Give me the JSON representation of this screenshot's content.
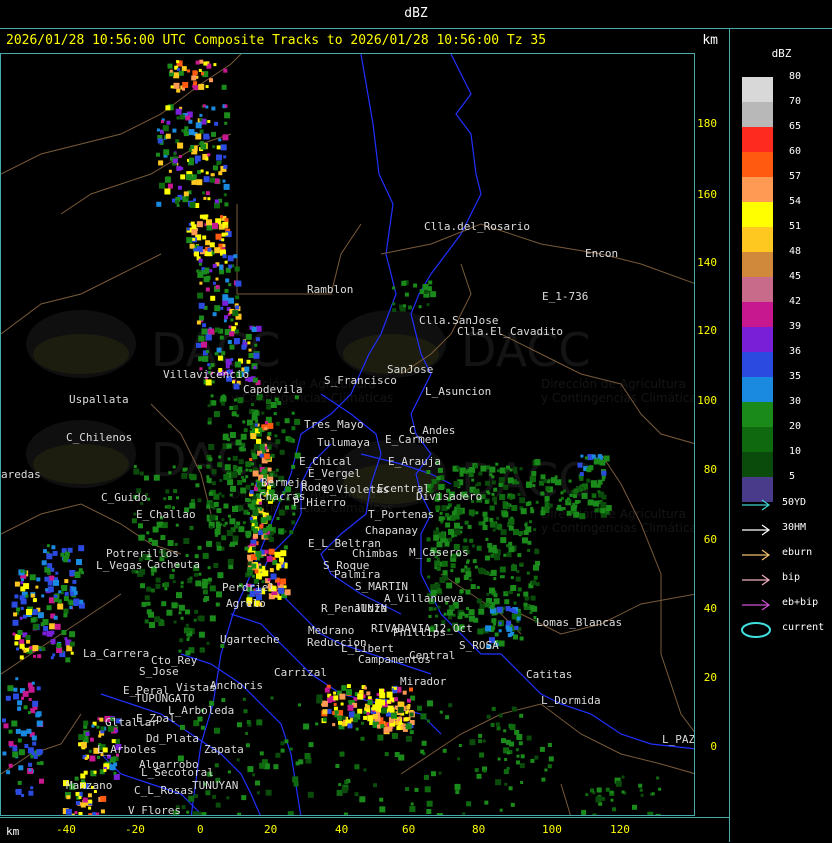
{
  "window_title": "dBZ",
  "header": {
    "title": "2026/01/28 10:56:00 UTC Composite Tracks to 2026/01/28 10:56:00 Tz 35",
    "km_label": "km"
  },
  "axes": {
    "y_ticks": [
      "180",
      "160",
      "140",
      "120",
      "100",
      "80",
      "60",
      "40",
      "20",
      "0"
    ],
    "x_ticks": [
      "-40",
      "-20",
      "0",
      "20",
      "40",
      "60",
      "80",
      "100",
      "120"
    ],
    "km_label": "km"
  },
  "scale": {
    "title": "dBZ",
    "levels": [
      {
        "label": "80",
        "color": "#d8d8d8"
      },
      {
        "label": "70",
        "color": "#b8b8b8"
      },
      {
        "label": "65",
        "color": "#ff2a1f"
      },
      {
        "label": "60",
        "color": "#ff5a10"
      },
      {
        "label": "57",
        "color": "#ff9a55"
      },
      {
        "label": "54",
        "color": "#ffff00"
      },
      {
        "label": "51",
        "color": "#ffc820"
      },
      {
        "label": "48",
        "color": "#d0883a"
      },
      {
        "label": "45",
        "color": "#c86a8a"
      },
      {
        "label": "42",
        "color": "#c81890"
      },
      {
        "label": "39",
        "color": "#7a1fd8"
      },
      {
        "label": "36",
        "color": "#2a4ae0"
      },
      {
        "label": "35",
        "color": "#1a8ae0"
      },
      {
        "label": "30",
        "color": "#1a8a1a"
      },
      {
        "label": "20",
        "color": "#0f6a0f"
      },
      {
        "label": "10",
        "color": "#0a4a0a"
      },
      {
        "label": "5",
        "color": "#4a3a8a"
      }
    ]
  },
  "tracks": [
    {
      "label": "50YD",
      "color": "#40d0d0",
      "icon": "arrow-icon"
    },
    {
      "label": "30HM",
      "color": "#ffffff",
      "icon": "arrow-icon"
    },
    {
      "label": "eburn",
      "color": "#f0c070",
      "icon": "arrow-icon"
    },
    {
      "label": "bip",
      "color": "#f0b0c0",
      "icon": "arrow-icon"
    },
    {
      "label": "eb+bip",
      "color": "#d050d0",
      "icon": "arrow-icon"
    },
    {
      "label": "current",
      "color": "#40e0e0",
      "icon": "ellipse-icon"
    }
  ],
  "places": [
    "Clla.del_Rosario",
    "Encon",
    "Ramblon",
    "E_1-736",
    "Clla.SanJose",
    "Clla.El_Cavadito",
    "S_Francisco",
    "SanJose",
    "L_Asuncion",
    "Villavicencio",
    "Uspallata",
    "Capdevila",
    "C_Chilenos",
    "Tres_Mayo",
    "Tulumaya",
    "E_Carmen",
    "C_Andes",
    "E_Arauja",
    "E_Chical",
    "E_Vergel",
    "Bermejo",
    "Rodeo",
    "L_Violetas",
    "Ecentral",
    "Divisadero",
    "C_Guido",
    "P_Hierro",
    "T_Portenas",
    "Chacras",
    "Chapanay",
    "E_Challao",
    "E_L_Beltran",
    "Chimbas",
    "M_Caseros",
    "Potrerillos",
    "Cacheuta",
    "S_Roque",
    "L_Vegas",
    "Palmira",
    "S_MARTIN",
    "Perdriel",
    "A_Villanueva",
    "Agrelo",
    "R_Penaloza",
    "JUNIN",
    "RIVADAVIA",
    "Phillips",
    "12_Oct",
    "Lomas_Blancas",
    "Medrano",
    "Reduccion",
    "S_ROSA",
    "Ugarteche",
    "L_Libert",
    "Campamentos",
    "Central",
    "La_Carrera",
    "Cto_Rey",
    "S_Jose",
    "Carrizal",
    "Catitas",
    "E_Peral",
    "Vistas",
    "Anchoris",
    "Mirador",
    "TUPUNGATO",
    "L_Arboleda",
    "L_Dormida",
    "Gltallar",
    "E_Zpal",
    "Dd_Plata",
    "L_Arboles",
    "Zapata",
    "L_PAZ",
    "Algarrobo",
    "L_Secotoral",
    "TUNUYAN",
    "Manzano",
    "C_L_Rosas",
    "V_Flores",
    "aredas"
  ],
  "watermark": {
    "brand": "DACC",
    "line1": "Dirección de Agricultura",
    "line2": "y Contingencias Climáticas"
  }
}
